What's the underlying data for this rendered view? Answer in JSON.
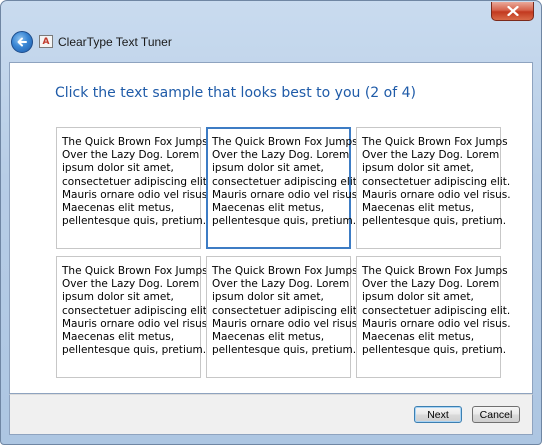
{
  "window": {
    "title": "ClearType Text Tuner",
    "app_icon_glyph": "A",
    "close_glyph": "close-icon"
  },
  "main": {
    "heading": "Click the text sample that looks best to you (2 of 4)",
    "samples": [
      {
        "text": "The Quick Brown Fox Jumps\nOver the Lazy Dog. Lorem\nipsum dolor sit amet,\nconsectetuer adipiscing elit.\nMauris ornare odio vel risus.\nMaecenas elit metus,\npellentesque quis, pretium.",
        "selected": false
      },
      {
        "text": "The Quick Brown Fox Jumps\nOver the Lazy Dog. Lorem\nipsum dolor sit amet,\nconsectetuer adipiscing elit.\nMauris ornare odio vel risus.\nMaecenas elit metus,\npellentesque quis, pretium.",
        "selected": true
      },
      {
        "text": "The Quick Brown Fox Jumps\nOver the Lazy Dog. Lorem\nipsum dolor sit amet,\nconsectetuer adipiscing elit.\nMauris ornare odio vel risus.\nMaecenas elit metus,\npellentesque quis, pretium.",
        "selected": false
      },
      {
        "text": "The Quick Brown Fox Jumps\nOver the Lazy Dog. Lorem\nipsum dolor sit amet,\nconsectetuer adipiscing elit.\nMauris ornare odio vel risus.\nMaecenas elit metus,\npellentesque quis, pretium.",
        "selected": false
      },
      {
        "text": "The Quick Brown Fox Jumps\nOver the Lazy Dog. Lorem\nipsum dolor sit amet,\nconsectetuer adipiscing elit.\nMauris ornare odio vel risus.\nMaecenas elit metus,\npellentesque quis, pretium.",
        "selected": false
      },
      {
        "text": "The Quick Brown Fox Jumps\nOver the Lazy Dog. Lorem\nipsum dolor sit amet,\nconsectetuer adipiscing elit.\nMauris ornare odio vel risus.\nMaecenas elit metus,\npellentesque quis, pretium.",
        "selected": false
      }
    ]
  },
  "footer": {
    "next_label": "Next",
    "cancel_label": "Cancel"
  },
  "colors": {
    "heading": "#1f5ba8",
    "selected_border": "#3d7cc4",
    "close_button": "#c2391f"
  }
}
